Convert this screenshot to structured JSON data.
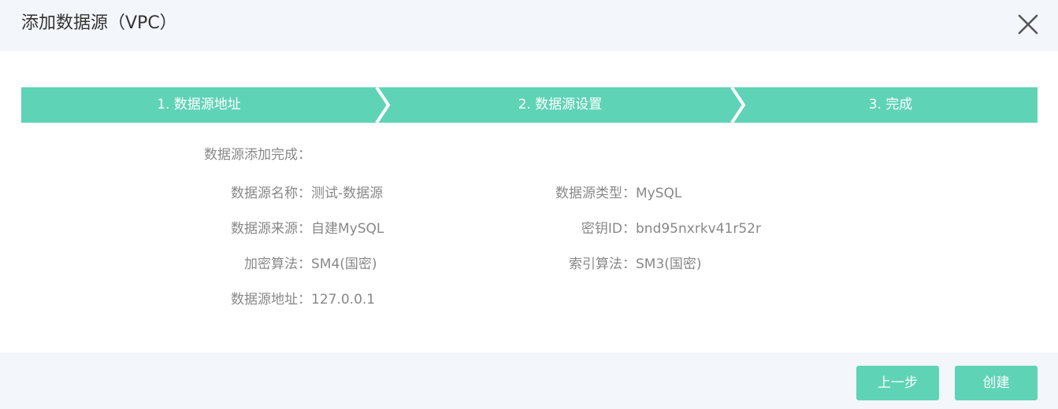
{
  "dialog": {
    "title": "添加数据源（VPC）"
  },
  "steps": [
    {
      "label": "1. 数据源地址"
    },
    {
      "label": "2. 数据源设置"
    },
    {
      "label": "3. 完成"
    }
  ],
  "colors": {
    "accent": "#5fd3b6",
    "header_bg": "#f3f6fa",
    "text_muted": "#888888"
  },
  "summary": {
    "heading": "数据源添加完成：",
    "name_label": "数据源名称：",
    "name_value": "测试-数据源",
    "type_label": "数据源类型：",
    "type_value": "MySQL",
    "source_label": "数据源来源：",
    "source_value": "自建MySQL",
    "key_label": "密钥ID：",
    "key_value": "bnd95nxrkv41r52r",
    "encrypt_label": "加密算法：",
    "encrypt_value": "SM4(国密)",
    "index_label": "索引算法：",
    "index_value": "SM3(国密)",
    "address_label": "数据源地址：",
    "address_value": "127.0.0.1"
  },
  "footer": {
    "prev_label": "上一步",
    "create_label": "创建"
  }
}
